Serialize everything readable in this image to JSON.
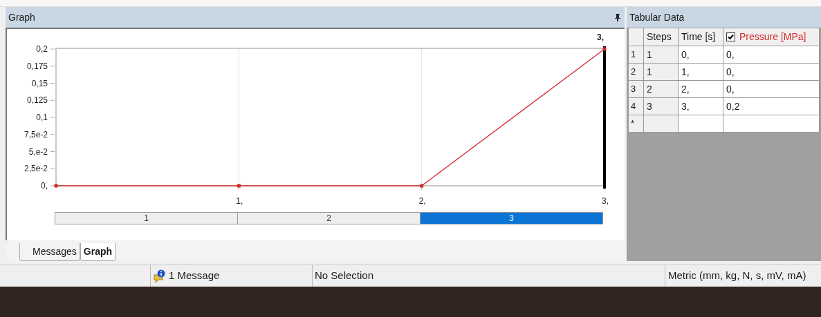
{
  "graph_panel": {
    "title": "Graph",
    "chart_data": {
      "type": "line",
      "x": [
        0,
        1,
        2,
        3
      ],
      "xlim": [
        0,
        3
      ],
      "ylim": [
        0,
        0.2
      ],
      "series": [
        {
          "color": "#d42a2a",
          "marker": "square",
          "values": [
            0,
            0,
            0,
            0.2
          ]
        }
      ],
      "xticks": [
        {
          "value": 1,
          "label": "1,"
        },
        {
          "value": 2,
          "label": "2,"
        },
        {
          "value": 3,
          "label": "3,"
        }
      ],
      "yticks": [
        {
          "value": 0,
          "label": "0,"
        },
        {
          "value": 0.025,
          "label": "2,5e-2"
        },
        {
          "value": 0.05,
          "label": "5,e-2"
        },
        {
          "value": 0.075,
          "label": "7,5e-2"
        },
        {
          "value": 0.1,
          "label": "0,1"
        },
        {
          "value": 0.125,
          "label": "0,125"
        },
        {
          "value": 0.15,
          "label": "0,15"
        },
        {
          "value": 0.175,
          "label": "0,175"
        },
        {
          "value": 0.2,
          "label": "0,2"
        }
      ]
    },
    "time_marker": {
      "label": "3,"
    },
    "steps": [
      {
        "label": "1",
        "selected": false
      },
      {
        "label": "2",
        "selected": false
      },
      {
        "label": "3",
        "selected": true
      }
    ],
    "tabs": [
      {
        "label": "Messages",
        "selected": false
      },
      {
        "label": "Graph",
        "selected": true
      }
    ]
  },
  "tabular_data": {
    "title": "Tabular Data",
    "columns": [
      {
        "label": "Steps"
      },
      {
        "label": "Time [s]"
      },
      {
        "label": "Pressure [MPa]",
        "checked": true
      }
    ],
    "rows": [
      {
        "number": "1",
        "cells": [
          "1",
          "0,",
          "0,"
        ]
      },
      {
        "number": "2",
        "cells": [
          "1",
          "1,",
          "0,"
        ]
      },
      {
        "number": "3",
        "cells": [
          "2",
          "2,",
          "0,"
        ]
      },
      {
        "number": "4",
        "cells": [
          "3",
          "3,",
          "0,2"
        ]
      },
      {
        "number": "*",
        "cells": [
          "",
          "",
          ""
        ]
      }
    ]
  },
  "status_bar": {
    "messages": "1 Message",
    "selection": "No Selection",
    "units": "Metric (mm, kg, N, s, mV, mA)"
  }
}
